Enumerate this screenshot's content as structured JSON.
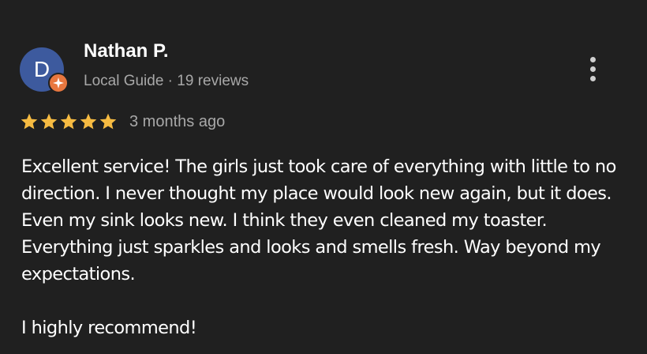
{
  "reviewer": {
    "avatar_initial": "D",
    "name": "Nathan P.",
    "meta": "Local Guide · 19 reviews"
  },
  "icons": {
    "more": "more-vert-icon",
    "badge": "local-guide-badge-icon",
    "star": "star-icon"
  },
  "colors": {
    "background": "#202020",
    "avatar": "#3d5a9e",
    "badge": "#e8773f",
    "star": "#f6bb42",
    "secondary_text": "#a8a8a8"
  },
  "review": {
    "rating": 5,
    "rating_max": 5,
    "date": "3 months ago",
    "paragraphs": [
      "Excellent service! The girls just took care of everything with little to no direction. I never thought my place would look new again, but it does. Even my sink looks new. I think they even cleaned my toaster. Everything just sparkles and looks and smells fresh. Way beyond my expectations.",
      "I highly recommend!"
    ]
  }
}
